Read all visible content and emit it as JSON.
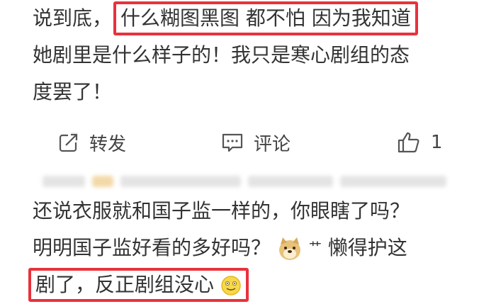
{
  "post": {
    "line1_prefix": "说到底，",
    "line1_highlight": "什么糊图黑图 都不怕 因为我知道",
    "line2": "她剧里是什么样子的！我只是寒心剧组的态",
    "line3": "度罢了！"
  },
  "actions": {
    "repost_label": "转发",
    "comment_label": "评论",
    "like_count": "1"
  },
  "comment": {
    "line1": "还说衣服就和国子监一样的，你眼瞎了吗？",
    "line2_prefix": "明明国子监好看的多好吗？",
    "line2_emoji_sign": "艹",
    "line2_suffix": "懒得护这",
    "line3_highlight": "剧了，反正剧组没心"
  },
  "icons": {
    "repost": "repost-icon",
    "comment": "comment-icon",
    "like": "thumbs-up-icon",
    "doge": "doge-emoji-icon",
    "smile": "smile-emoji-icon"
  },
  "colors": {
    "highlight_border": "#e8323c",
    "text": "#333333"
  }
}
